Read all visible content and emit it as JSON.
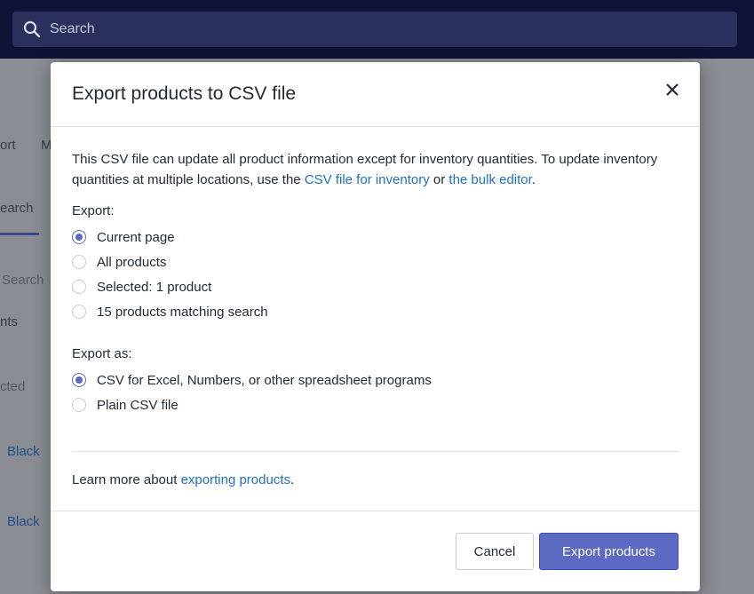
{
  "topbar": {
    "search_placeholder": "Search"
  },
  "background": {
    "tab_partial_1": "ort",
    "tab_partial_2": "M",
    "search_tab": "earch",
    "filter_search": "Search",
    "chip_text": "nts",
    "selected_text": "cted",
    "row1": "Black",
    "row2": "Black"
  },
  "modal": {
    "title": "Export products to CSV file",
    "description_pre": "This CSV file can update all product information except for inventory quantities. To update inventory quantities at multiple locations, use the ",
    "link_inventory": "CSV file for inventory",
    "description_mid": " or ",
    "link_bulk": "the bulk editor",
    "description_post": ".",
    "export_label": "Export:",
    "export_options": [
      "Current page",
      "All products",
      "Selected: 1 product",
      "15 products matching search"
    ],
    "export_as_label": "Export as:",
    "export_as_options": [
      "CSV for Excel, Numbers, or other spreadsheet programs",
      "Plain CSV file"
    ],
    "learn_pre": "Learn more about ",
    "learn_link": "exporting products",
    "learn_post": ".",
    "cancel_label": "Cancel",
    "export_button_label": "Export products"
  },
  "colors": {
    "accent": "#5c6ac4",
    "link": "#2270c2",
    "topbar": "#0f1337"
  }
}
